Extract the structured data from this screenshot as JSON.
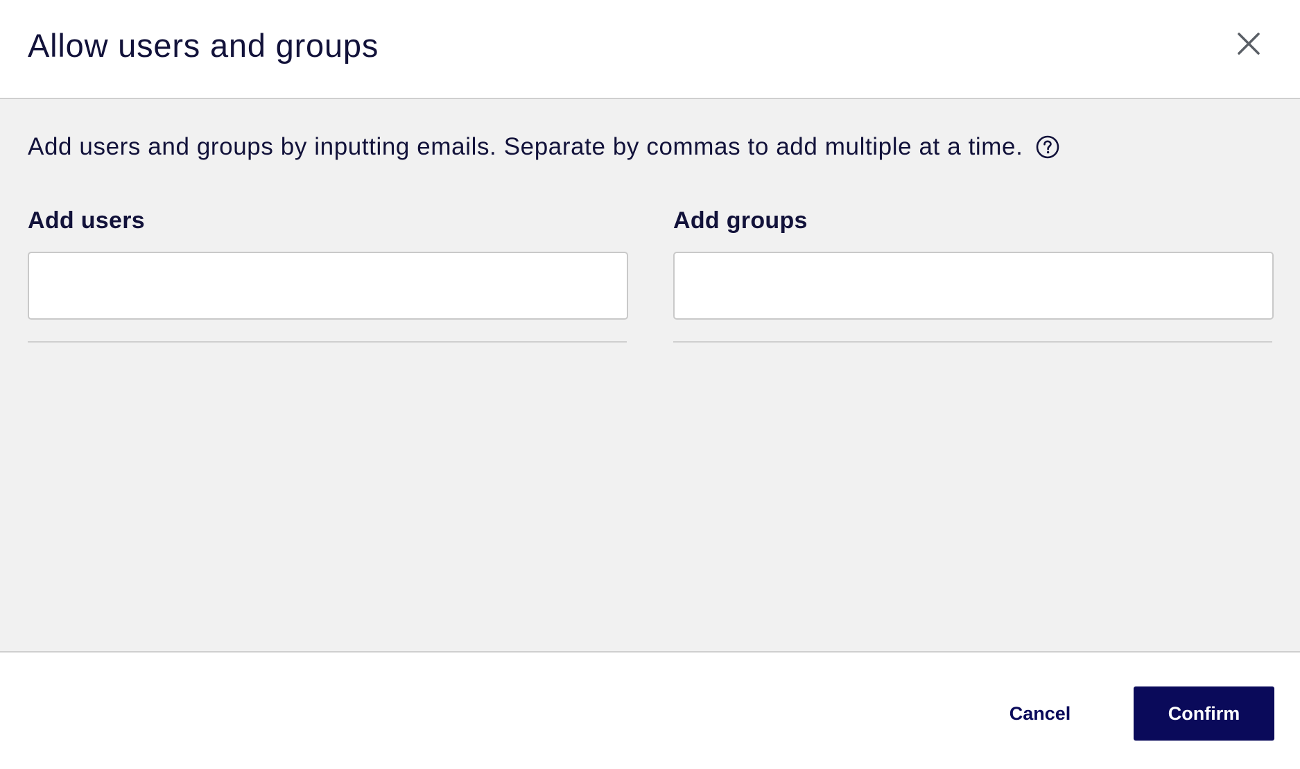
{
  "dialog": {
    "title": "Allow users and groups",
    "close_icon": "close-icon"
  },
  "body": {
    "hint": "Add users and groups by inputting emails. Separate by commas to add multiple at a time.",
    "help_icon": "question-circle-icon",
    "users": {
      "label": "Add users",
      "value": "",
      "placeholder": ""
    },
    "groups": {
      "label": "Add groups",
      "value": "",
      "placeholder": ""
    }
  },
  "footer": {
    "cancel_label": "Cancel",
    "confirm_label": "Confirm"
  },
  "colors": {
    "text": "#12123a",
    "primary": "#0a0a5a",
    "body_bg": "#f1f1f1",
    "border": "#cfcfcf"
  }
}
